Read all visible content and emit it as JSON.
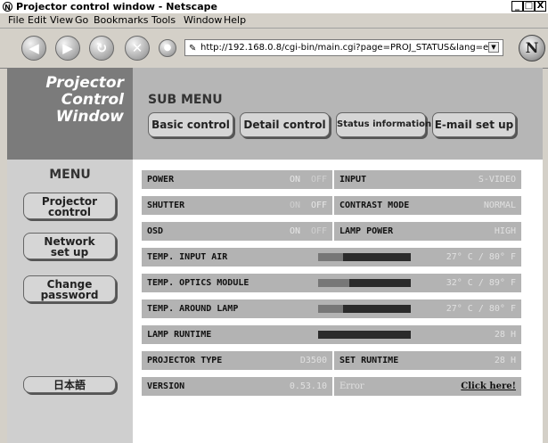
{
  "window": {
    "title": "Projector control window - Netscape",
    "minimize": "_",
    "maximize": "□",
    "close": "X"
  },
  "menubar": [
    "File",
    "Edit",
    "View",
    "Go",
    "Bookmarks",
    "Tools",
    "Window",
    "Help"
  ],
  "toolbar": {
    "url": "http://192.168.0.8/cgi-bin/main.cgi?page=PROJ_STATUS&lang=e"
  },
  "brand": {
    "line1": "Projector",
    "line2": "Control",
    "line3": "Window"
  },
  "submenu": {
    "title": "SUB MENU",
    "buttons": [
      "Basic control",
      "Detail control",
      "Status information",
      "E-mail set up"
    ]
  },
  "menu": {
    "title": "MENU",
    "projector_control": [
      "Projector",
      "control"
    ],
    "network_setup": [
      "Network",
      "set up"
    ],
    "change_password": [
      "Change",
      "password"
    ],
    "japanese": "日本語"
  },
  "status": {
    "power": {
      "label": "POWER",
      "on": "ON",
      "off": "OFF"
    },
    "shutter": {
      "label": "SHUTTER",
      "on": "ON",
      "off": "OFF"
    },
    "osd": {
      "label": "OSD",
      "on": "ON",
      "off": "OFF"
    },
    "input": {
      "label": "INPUT",
      "value": "S-VIDEO"
    },
    "contrast_mode": {
      "label": "CONTRAST MODE",
      "value": "NORMAL"
    },
    "lamp_power": {
      "label": "LAMP POWER",
      "value": "HIGH"
    },
    "temp_input_air": {
      "label": "TEMP. INPUT AIR",
      "value": "27° C / 80° F",
      "level": 0.27
    },
    "temp_optics": {
      "label": "TEMP. OPTICS MODULE",
      "value": "32° C / 89° F",
      "level": 0.34
    },
    "temp_lamp": {
      "label": "TEMP. AROUND LAMP",
      "value": "27° C / 80° F",
      "level": 0.27
    },
    "lamp_runtime": {
      "label": "LAMP RUNTIME",
      "value": "28 H"
    },
    "projector_type": {
      "label": "PROJECTOR TYPE",
      "value": "D3500"
    },
    "set_runtime": {
      "label": "SET RUNTIME",
      "value": "28 H"
    },
    "version": {
      "label": "VERSION",
      "value": "0.53.10"
    },
    "error": {
      "label": "Error",
      "link": "Click here!"
    }
  }
}
